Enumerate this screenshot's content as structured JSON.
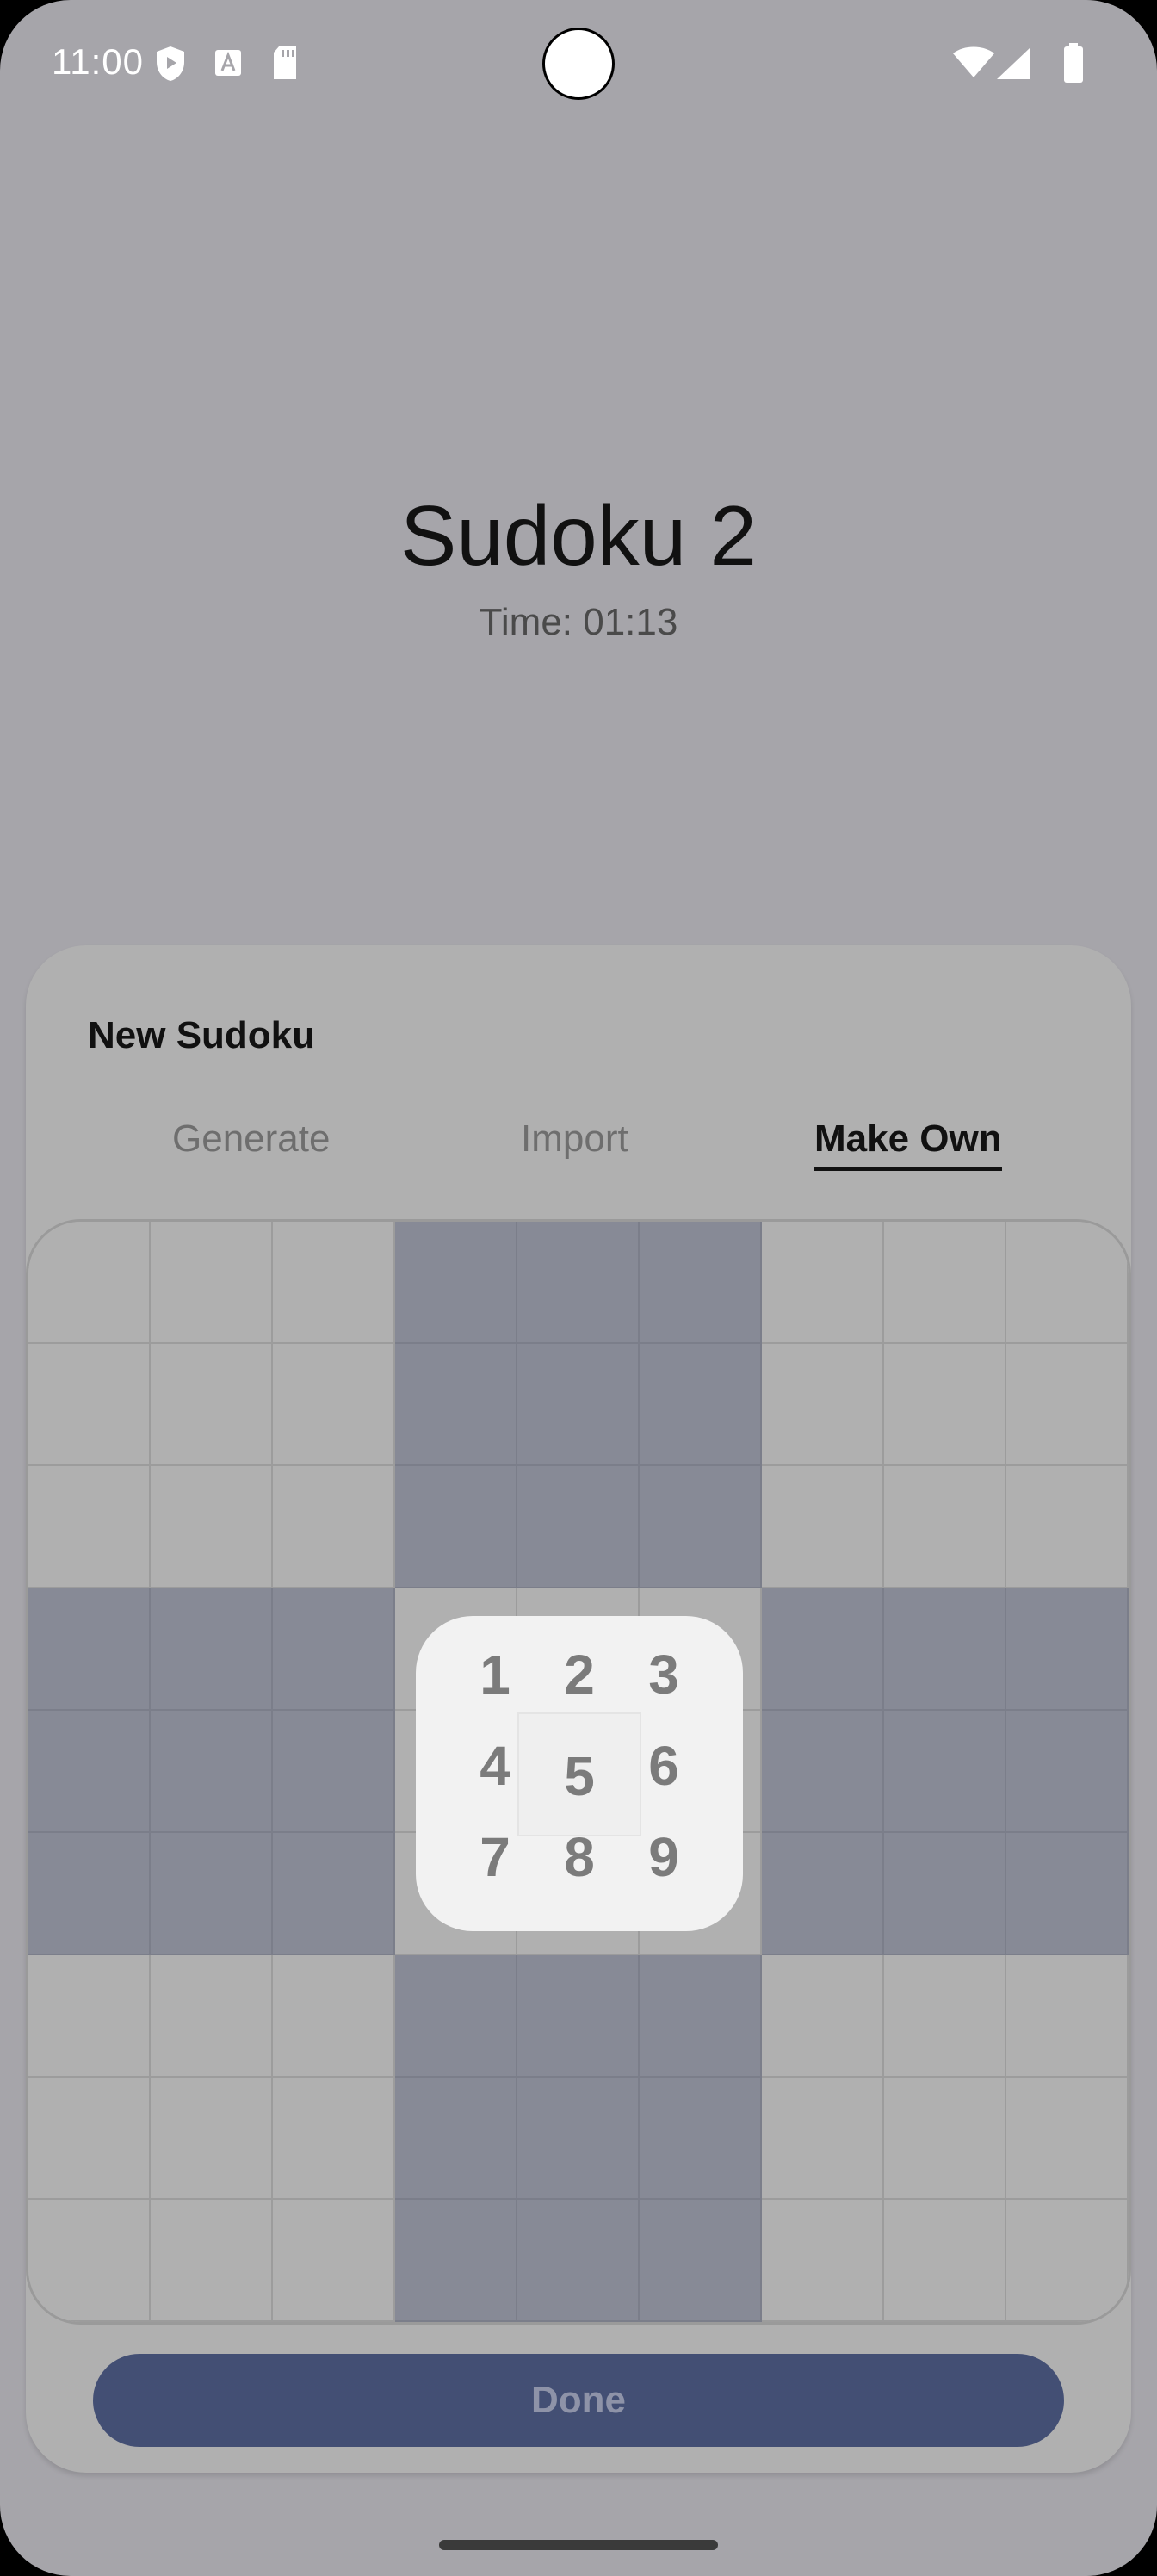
{
  "status_bar": {
    "time": "11:00",
    "left_icons": [
      "shield-play-icon",
      "a-font-icon",
      "sd-card-icon"
    ],
    "right_icons": [
      "wifi-icon",
      "cell-signal-icon",
      "battery-icon"
    ]
  },
  "header": {
    "title": "Sudoku 2",
    "timer": "Time: 01:13"
  },
  "sheet": {
    "title": "New Sudoku",
    "tabs": [
      {
        "label": "Generate",
        "active": false
      },
      {
        "label": "Import",
        "active": false
      },
      {
        "label": "Make Own",
        "active": true
      }
    ],
    "grid": {
      "rows": 9,
      "cols": 9,
      "highlighted_row": 5,
      "highlighted_col": 5
    },
    "picker": {
      "digits": [
        "1",
        "2",
        "3",
        "4",
        "5",
        "6",
        "7",
        "8",
        "9"
      ],
      "selected": "5"
    },
    "done_label": "Done"
  },
  "colors": {
    "background": "#a6a5aa",
    "sheet": "#b0b0b0",
    "highlight": "#878a96",
    "done_button": "#434f74"
  }
}
